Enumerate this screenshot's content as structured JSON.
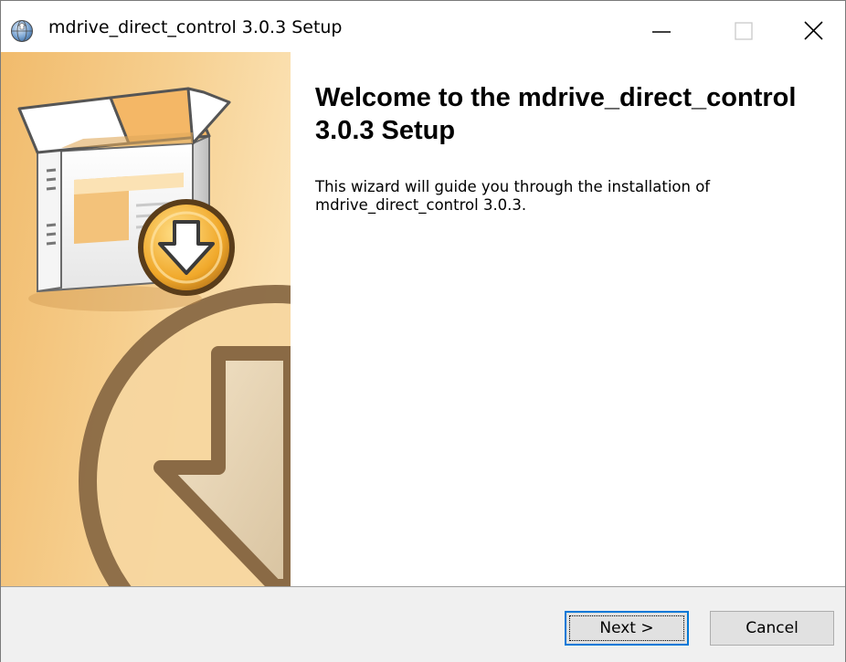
{
  "window": {
    "title": "mdrive_direct_control 3.0.3 Setup"
  },
  "welcome": {
    "title": "Welcome to the mdrive_direct_control 3.0.3 Setup",
    "body": "This wizard will guide you through the installation of mdrive_direct_control 3.0.3."
  },
  "buttons": {
    "next_label": "Next >",
    "cancel_label": "Cancel"
  },
  "icons": {
    "app": "installer-globe-icon",
    "minimize": "minimize-icon",
    "maximize": "maximize-icon",
    "close": "close-icon",
    "sidebar_art": "install-box-download-icon"
  },
  "colors": {
    "sidebar_base": "#f3c27a",
    "sidebar_light": "#fbe3b6",
    "accent_focus": "#0078d7",
    "footer_bg": "#f0f0f0"
  }
}
